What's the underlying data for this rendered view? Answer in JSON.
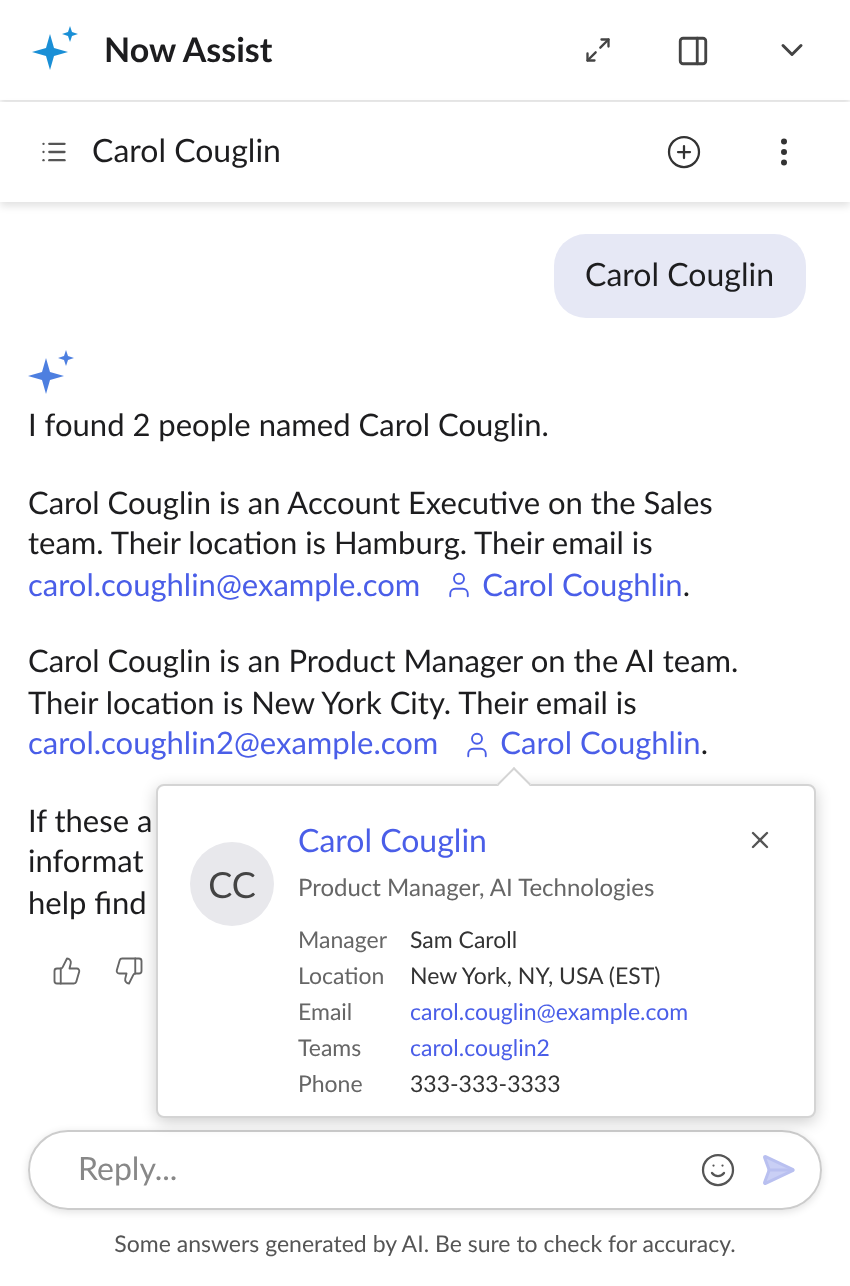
{
  "header": {
    "title": "Now Assist"
  },
  "conversation": {
    "title": "Carol Couglin"
  },
  "user_message": "Carol Couglin",
  "assistant_message": {
    "paragraphs": [
      [
        [
          {
            "kind": "text",
            "text": "I found 2 people named Carol Couglin."
          }
        ]
      ],
      [
        [
          {
            "kind": "text",
            "text": "Carol Couglin is an Account Executive on the Sales"
          }
        ],
        [
          {
            "kind": "text",
            "text": "team. Their location is Hamburg. Their email is"
          }
        ],
        [
          {
            "kind": "email",
            "text": "carol.coughlin@example.com"
          },
          {
            "kind": "person",
            "text": "Carol Coughlin"
          },
          {
            "kind": "text",
            "text": "."
          }
        ]
      ],
      [
        [
          {
            "kind": "text",
            "text": "Carol Couglin is an Product Manager on the AI team."
          }
        ],
        [
          {
            "kind": "text",
            "text": "Their location is New York City. Their email is"
          }
        ],
        [
          {
            "kind": "email",
            "text": "carol.coughlin2@example.com"
          },
          {
            "kind": "person",
            "text": "Carol Coughlin"
          },
          {
            "kind": "text",
            "text": "."
          }
        ]
      ],
      [
        [
          {
            "kind": "text",
            "text": "If these a"
          }
        ],
        [
          {
            "kind": "text",
            "text": "informat"
          }
        ],
        [
          {
            "kind": "text",
            "text": "help find"
          }
        ]
      ]
    ]
  },
  "person_card": {
    "initials": "CC",
    "name": "Carol Couglin",
    "subtitle": "Product Manager, AI Technologies",
    "fields": [
      {
        "label": "Manager",
        "value": "Sam Caroll",
        "kind": "text"
      },
      {
        "label": "Location",
        "value": "New York, NY, USA (EST)",
        "kind": "text"
      },
      {
        "label": "Email",
        "value": "carol.couglin@example.com",
        "kind": "link"
      },
      {
        "label": "Teams",
        "value": "carol.couglin2",
        "kind": "link"
      },
      {
        "label": "Phone",
        "value": "333-333-3333",
        "kind": "text"
      }
    ]
  },
  "reply": {
    "placeholder": "Reply..."
  },
  "disclaimer": "Some answers generated by AI. Be sure to check for accuracy."
}
